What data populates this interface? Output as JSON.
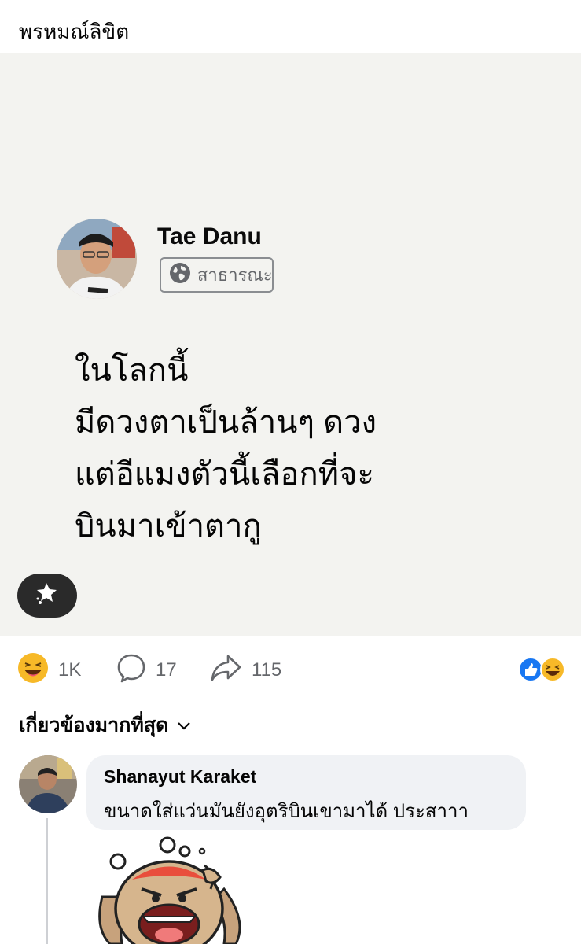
{
  "header": {
    "title": "พรหมณ์ลิขิต"
  },
  "post": {
    "author": "Tae Danu",
    "privacy": "สาธารณะ",
    "lines": [
      "ในโลกนี้",
      "มีดวงตาเป็นล้านๆ ดวง",
      "แต่อีแมงตัวนี้เลือกที่จะ",
      "บินมาเข้าตากู"
    ],
    "background_color": "#f3f3f0"
  },
  "stats": {
    "reactions": "1K",
    "comments": "17",
    "shares": "115"
  },
  "comments_section": {
    "sort_label": "เกี่ยวข้องมากที่สุด"
  },
  "comment": {
    "author": "Shanayut Karaket",
    "text": "ขนาดใส่แว่นมันยังอุตริบินเขามาได้ ประสาาา"
  },
  "icons": {
    "privacy": "globe-icon",
    "reaction": "haha-icon",
    "comment": "comment-icon",
    "share": "share-icon",
    "like": "like-icon",
    "sparkle": "sparkle-icon",
    "chevron": "chevron-down-icon"
  },
  "colors": {
    "like_blue": "#1877f2",
    "haha_yellow": "#f7b928"
  }
}
